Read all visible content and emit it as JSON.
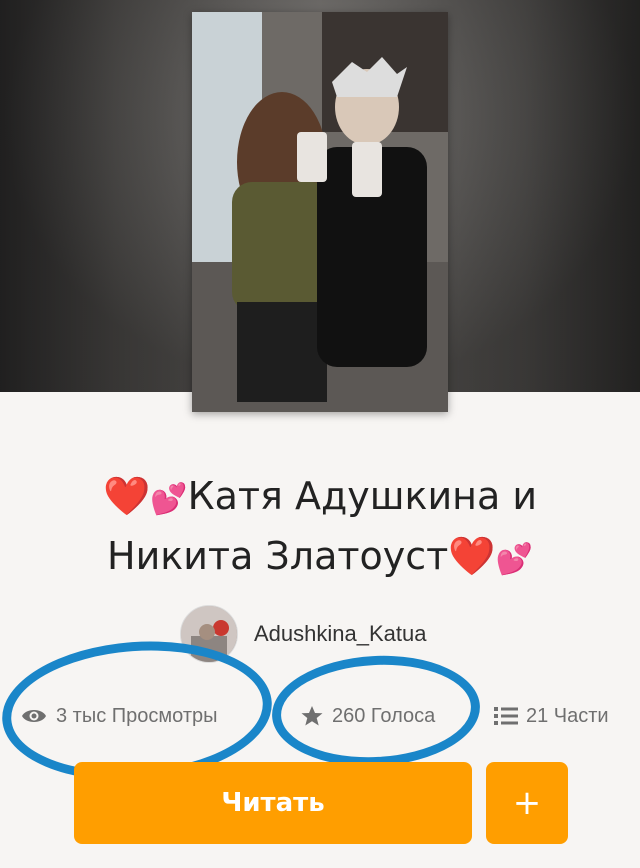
{
  "cover": {
    "alt_icon": "photo-cover"
  },
  "story": {
    "title_line1_text": "Катя Адушкина и",
    "title_line2_text": "Никита Златоуст",
    "heart": "❤️",
    "hearts": "💕"
  },
  "author": {
    "name": "Adushkina_Katua"
  },
  "stats": {
    "views": "3 тыс Просмотры",
    "votes": "260 Голоса",
    "parts": "21 Части"
  },
  "actions": {
    "read_label": "Читать",
    "add_label": "+"
  },
  "colors": {
    "accent": "#ff9e00",
    "annotation": "#1a86c9"
  }
}
